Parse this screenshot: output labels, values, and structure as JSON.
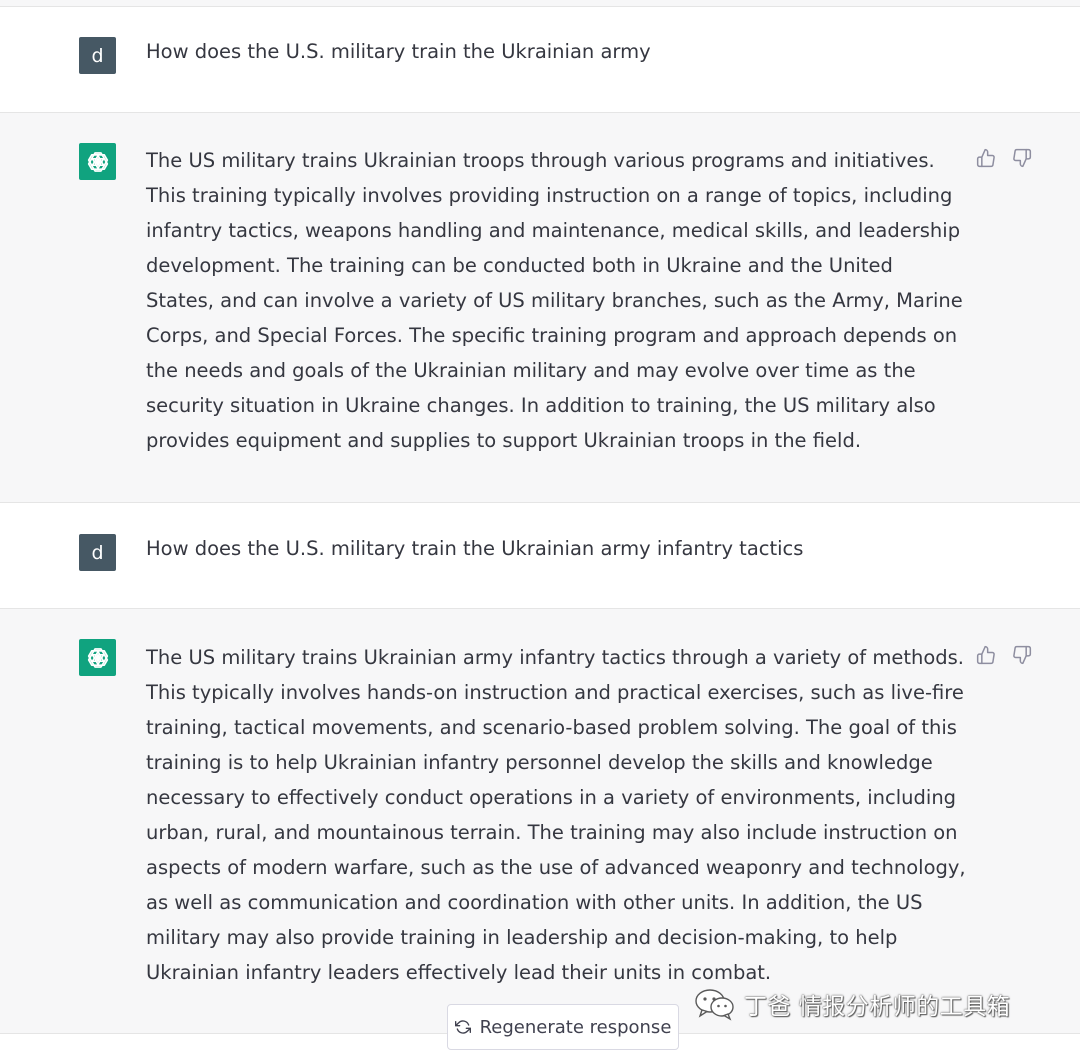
{
  "conversation": {
    "messages": [
      {
        "role": "user",
        "avatar_letter": "d",
        "text": "How does the U.S. military train the Ukrainian army"
      },
      {
        "role": "assistant",
        "text": "The US military trains Ukrainian troops through various programs and initiatives. This training typically involves providing instruction on a range of topics, including infantry tactics, weapons handling and maintenance, medical skills, and leadership development. The training can be conducted both in Ukraine and the United States, and can involve a variety of US military branches, such as the Army, Marine Corps, and Special Forces. The specific training program and approach depends on the needs and goals of the Ukrainian military and may evolve over time as the security situation in Ukraine changes. In addition to training, the US military also provides equipment and supplies to support Ukrainian troops in the field."
      },
      {
        "role": "user",
        "avatar_letter": "d",
        "text": "How does the U.S. military train the Ukrainian army infantry tactics"
      },
      {
        "role": "assistant",
        "text": "The US military trains Ukrainian army infantry tactics through a variety of methods. This typically involves hands-on instruction and practical exercises, such as live-fire training, tactical movements, and scenario-based problem solving. The goal of this training is to help Ukrainian infantry personnel develop the skills and knowledge necessary to effectively conduct operations in a variety of environments, including urban, rural, and mountainous terrain. The training may also include instruction on aspects of modern warfare, such as the use of advanced weaponry and technology, as well as communication and coordination with other units. In addition, the US military may also provide training in leadership and decision-making, to help Ukrainian infantry leaders effectively lead their units in combat."
      }
    ]
  },
  "regenerate": {
    "label": "Regenerate response",
    "icon": "refresh-icon"
  },
  "watermark": {
    "text": "丁爸 情报分析师的工具箱",
    "icon": "wechat-icon"
  },
  "icons": {
    "assistant_avatar": "openai-logo-icon",
    "like": "thumbs-up-icon",
    "dislike": "thumbs-down-icon"
  },
  "colors": {
    "assistant_bg": "#f7f7f8",
    "user_avatar_bg": "#465864",
    "assistant_avatar_bg": "#10a37f",
    "text": "#353740"
  }
}
